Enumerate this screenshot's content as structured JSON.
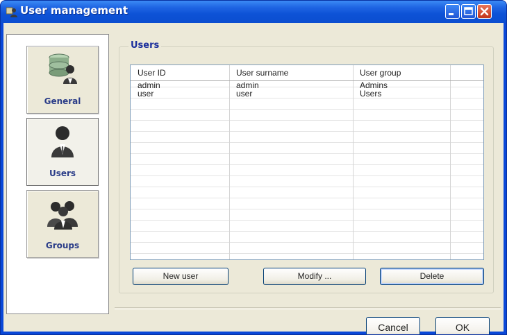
{
  "window": {
    "title": "User management",
    "icon": "user-management-app-icon"
  },
  "titlebar_buttons": {
    "minimize_icon": "minimize-icon",
    "maximize_icon": "maximize-icon",
    "close_icon": "close-icon"
  },
  "sidebar": {
    "items": [
      {
        "label": "General",
        "icon": "database-user-icon",
        "selected": false
      },
      {
        "label": "Users",
        "icon": "user-icon",
        "selected": true
      },
      {
        "label": "Groups",
        "icon": "users-group-icon",
        "selected": false
      }
    ]
  },
  "users_panel": {
    "title": "Users",
    "columns": [
      "User ID",
      "User surname",
      "User group"
    ],
    "rows": [
      [
        "admin",
        "admin",
        "Admins"
      ],
      [
        "user",
        "user",
        "Users"
      ]
    ],
    "buttons": {
      "new_user": "New user",
      "modify": "Modify ...",
      "delete": "Delete"
    }
  },
  "dialog_buttons": {
    "cancel": "Cancel",
    "ok": "OK"
  },
  "colors": {
    "titlebar": "#0c4ed0",
    "dialog_bg": "#ece9d8",
    "accent_text": "#1a2e9c",
    "close_button": "#c2351a"
  }
}
